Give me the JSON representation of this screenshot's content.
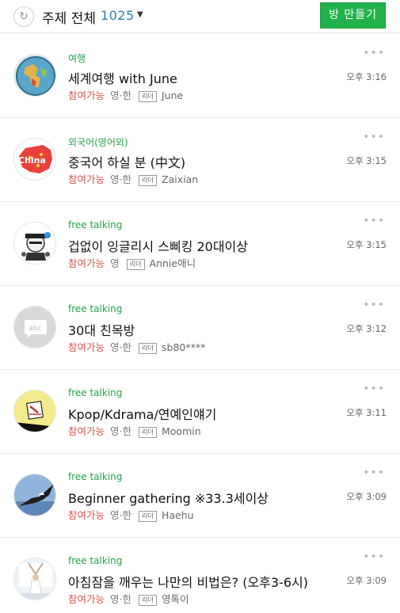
{
  "header": {
    "refresh_icon": "refresh-icon",
    "title": "주제 전체",
    "count": "1025",
    "dropdown_icon": "caret-down-icon",
    "create_button": "방 만들기"
  },
  "rooms": [
    {
      "category": "여행",
      "title": "세계여행 with June",
      "status": "참여가능",
      "languages": "영·한",
      "leader_badge": "리더",
      "leader": "June",
      "time": "오후 3:16",
      "more_icon": "more-dots-icon",
      "avatar": "globe-avatar"
    },
    {
      "category": "외국어(영어외)",
      "title": "중국어 하실 분 (中文)",
      "status": "참여가능",
      "languages": "영·한",
      "leader_badge": "리더",
      "leader": "Zaixian",
      "time": "오후 3:15",
      "more_icon": "more-dots-icon",
      "avatar": "china-map-avatar"
    },
    {
      "category": "free talking",
      "title": "겁없이 잉글리시 스삐킹 20대이상",
      "status": "참여가능",
      "languages": "영",
      "leader_badge": "리더",
      "leader": "Annie애니",
      "time": "오후 3:15",
      "more_icon": "more-dots-icon",
      "avatar": "character-avatar"
    },
    {
      "category": "free talking",
      "title": "30대 친목방",
      "status": "참여가능",
      "languages": "영·한",
      "leader_badge": "리더",
      "leader": "sb80****",
      "time": "오후 3:12",
      "more_icon": "more-dots-icon",
      "avatar": "abc-chat-avatar"
    },
    {
      "category": "free talking",
      "title": "Kpop/Kdrama/연예인얘기",
      "status": "참여가능",
      "languages": "영·한",
      "leader_badge": "리더",
      "leader": "Moomin",
      "time": "오후 3:11",
      "more_icon": "more-dots-icon",
      "avatar": "drawing-avatar"
    },
    {
      "category": "free talking",
      "title": "Beginner gathering ※33.3세이상",
      "status": "참여가능",
      "languages": "영·한",
      "leader_badge": "리더",
      "leader": "Haehu",
      "time": "오후 3:09",
      "more_icon": "more-dots-icon",
      "avatar": "eagle-avatar"
    },
    {
      "category": "free talking",
      "title": "아침잠을 깨우는 나만의 비법은? (오후3-6시)",
      "status": "참여가능",
      "languages": "영·한",
      "leader_badge": "리더",
      "leader": "영톡이",
      "time": "오후 3:09",
      "more_icon": "more-dots-icon",
      "avatar": "woman-stretching-avatar"
    }
  ],
  "colors": {
    "accent_green": "#22b24b",
    "category_green": "#25a24a",
    "status_red": "#d9534f",
    "count_blue": "#2f7fb0"
  }
}
